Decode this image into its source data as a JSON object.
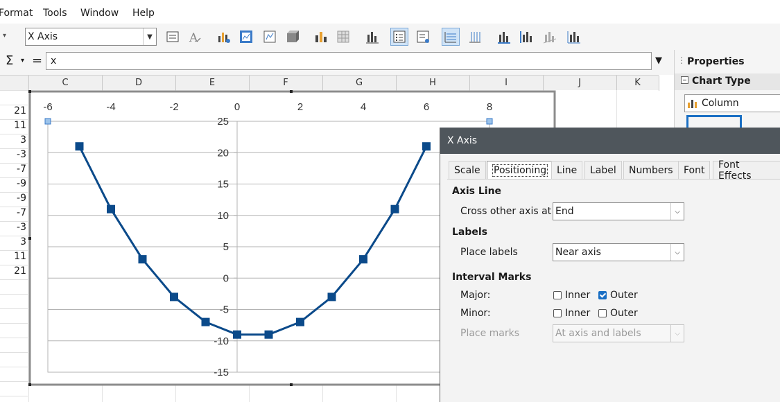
{
  "menu": [
    "Format",
    "Tools",
    "Window",
    "Help"
  ],
  "toolbar": {
    "element_select": "X Axis",
    "icons": [
      "format-selection-icon",
      "legend-icon",
      "chart-type-icon",
      "chart-area-icon",
      "chart-wall-icon",
      "3d-view-icon",
      "chart-type-2-icon",
      "data-table-icon",
      "insert-chart-icon",
      "legend-on-off-icon",
      "legend-format-icon",
      "horizontal-grids-icon",
      "vertical-grids-icon",
      "x-axis-icon",
      "y-axis-icon",
      "z-axis-icon",
      "all-axes-icon"
    ]
  },
  "formula": {
    "sigma": "Σ",
    "equals": "=",
    "value": "x"
  },
  "columns": [
    "C",
    "D",
    "E",
    "F",
    "G",
    "H",
    "I",
    "J",
    "K"
  ],
  "row_values": [
    "21",
    "11",
    "3",
    "-3",
    "-7",
    "-9",
    "-9",
    "-7",
    "-3",
    "3",
    "11",
    "21"
  ],
  "sidebar": {
    "title": "Properties",
    "section": "Chart Type",
    "chart_type_value": "Column"
  },
  "chart_data": {
    "type": "line",
    "x_ticks": [
      "-6",
      "-4",
      "-2",
      "0",
      "2",
      "4",
      "6",
      "8"
    ],
    "y_ticks": [
      "25",
      "20",
      "15",
      "10",
      "5",
      "0",
      "-5",
      "-10",
      "-15"
    ],
    "xlim": [
      -6,
      8
    ],
    "ylim": [
      -15,
      25
    ],
    "x_axis_position": "top",
    "series": [
      {
        "x": [
          -5,
          -4,
          -3,
          -2,
          -1,
          0,
          1,
          2,
          3,
          4,
          5,
          6
        ],
        "y": [
          21,
          11,
          3,
          -3,
          -7,
          -9,
          -9,
          -7,
          -3,
          3,
          11,
          21
        ]
      }
    ],
    "color": "#0b4a8a",
    "grid": true
  },
  "dialog": {
    "title": "X Axis",
    "tabs": [
      "Scale",
      "Positioning",
      "Line",
      "Label",
      "Numbers",
      "Font",
      "Font Effects"
    ],
    "selected_tab": "Positioning",
    "axis_line_heading": "Axis Line",
    "cross_label": "Cross other axis at",
    "cross_value": "End",
    "labels_heading": "Labels",
    "place_labels_label": "Place labels",
    "place_labels_value": "Near axis",
    "interval_heading": "Interval Marks",
    "major_label": "Major:",
    "minor_label": "Minor:",
    "inner": "Inner",
    "outer": "Outer",
    "major_inner": false,
    "major_outer": true,
    "minor_inner": false,
    "minor_outer": false,
    "place_marks_label": "Place marks",
    "place_marks_value": "At axis and labels"
  }
}
